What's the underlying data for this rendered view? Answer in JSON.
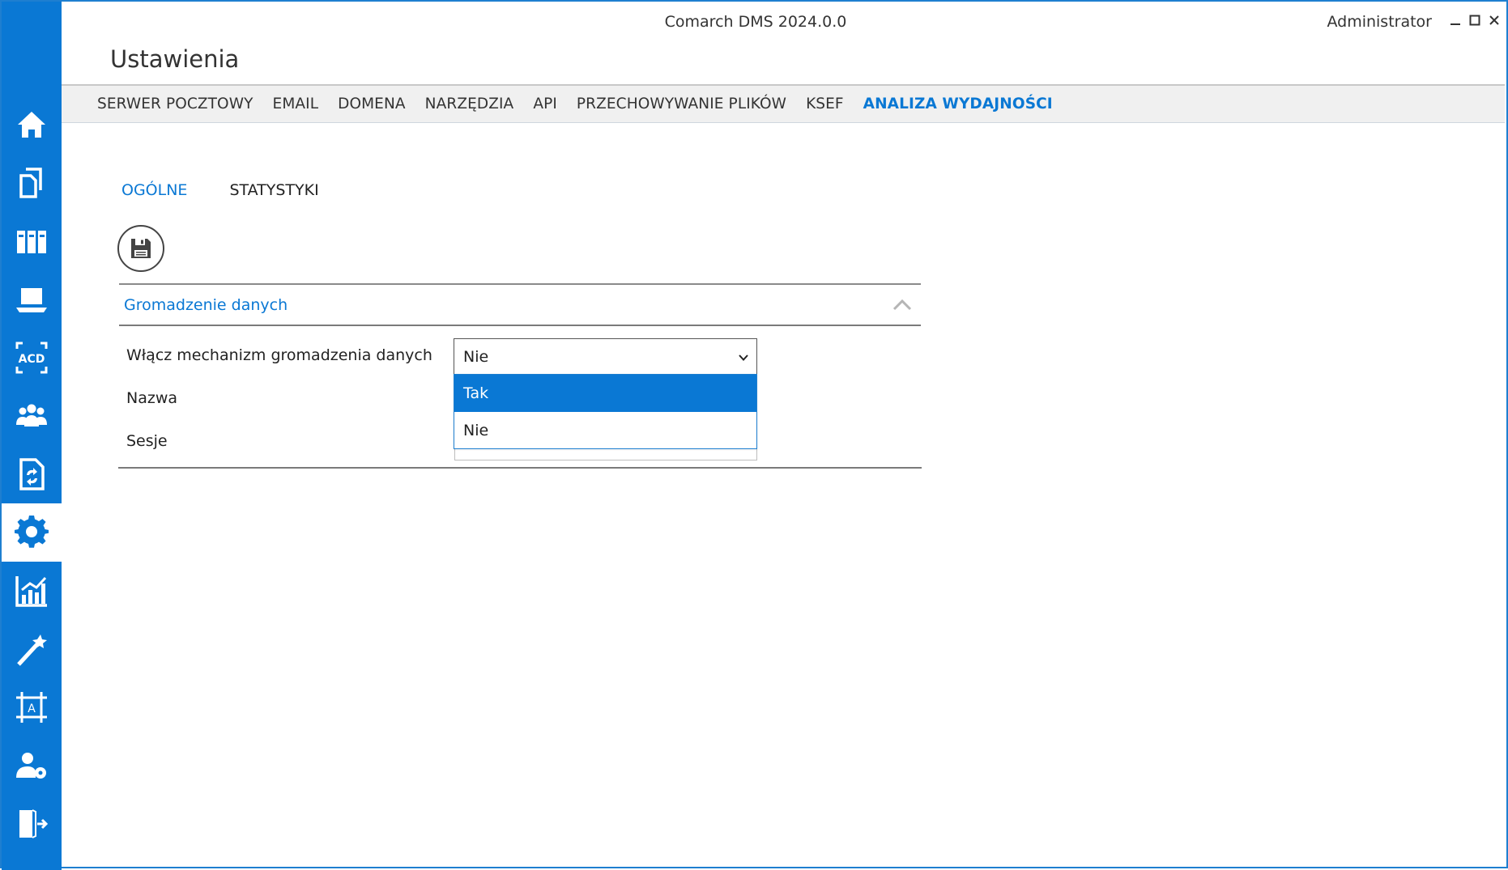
{
  "window": {
    "title": "Comarch DMS 2024.0.0",
    "user": "Administrator",
    "controls": {
      "minimize": "minimize-icon",
      "maximize": "maximize-icon",
      "close": "close-icon"
    }
  },
  "sidebar": {
    "items": [
      {
        "icon": "home-icon",
        "active": false
      },
      {
        "icon": "documents-icon",
        "active": false
      },
      {
        "icon": "binders-icon",
        "active": false
      },
      {
        "icon": "laptop-icon",
        "active": false
      },
      {
        "icon": "acd-icon",
        "label": "ACD",
        "active": false
      },
      {
        "icon": "users-group-icon",
        "active": false
      },
      {
        "icon": "document-sync-icon",
        "active": false
      },
      {
        "icon": "gear-icon",
        "active": true
      },
      {
        "icon": "analytics-chart-icon",
        "active": false
      },
      {
        "icon": "magic-wand-icon",
        "active": false
      },
      {
        "icon": "template-designer-icon",
        "label": "A",
        "active": false
      },
      {
        "icon": "user-settings-icon",
        "active": false
      },
      {
        "icon": "logout-icon",
        "active": false
      }
    ],
    "accent_color": "#0a78d4"
  },
  "page": {
    "title": "Ustawienia"
  },
  "top_tabs": [
    {
      "label": "SERWER POCZTOWY",
      "active": false
    },
    {
      "label": "EMAIL",
      "active": false
    },
    {
      "label": "DOMENA",
      "active": false
    },
    {
      "label": "NARZĘDZIA",
      "active": false
    },
    {
      "label": "API",
      "active": false
    },
    {
      "label": "PRZECHOWYWANIE PLIKÓW",
      "active": false
    },
    {
      "label": "KSEF",
      "active": false
    },
    {
      "label": "ANALIZA WYDAJNOŚCI",
      "active": true
    }
  ],
  "sub_tabs": [
    {
      "label": "OGÓLNE",
      "active": true
    },
    {
      "label": "STATYSTYKI",
      "active": false
    }
  ],
  "toolbar": {
    "save_icon": "save-icon"
  },
  "section": {
    "title": "Gromadzenie danych",
    "expanded": true,
    "fields": {
      "enable": {
        "label": "Włącz mechanizm gromadzenia danych",
        "value": "Nie"
      },
      "name": {
        "label": "Nazwa"
      },
      "sessions": {
        "label": "Sesje"
      }
    }
  },
  "dropdown": {
    "open": true,
    "options": [
      {
        "label": "Tak",
        "highlighted": true
      },
      {
        "label": "Nie",
        "highlighted": false
      }
    ]
  }
}
